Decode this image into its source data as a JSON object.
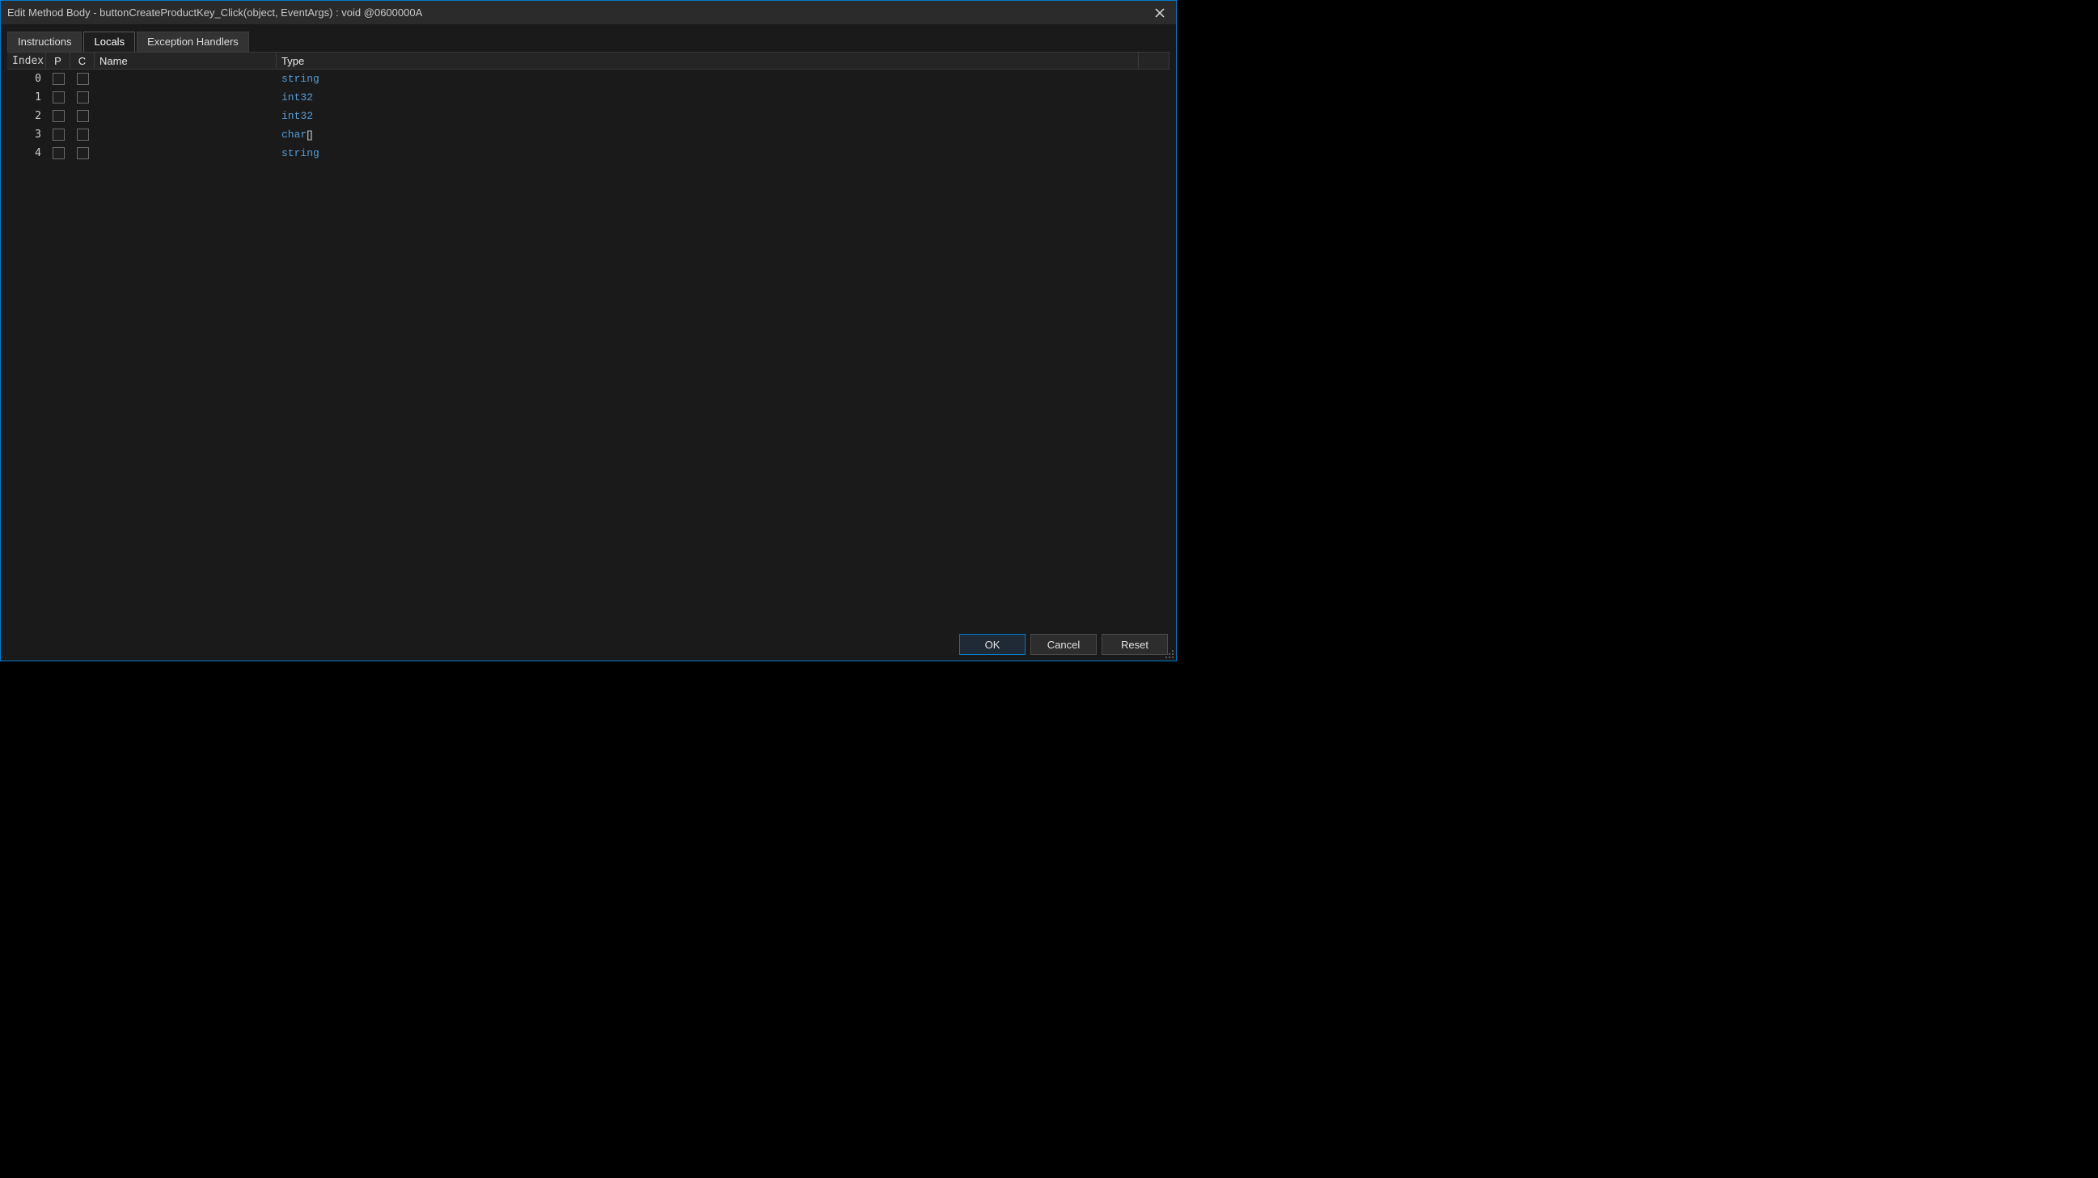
{
  "window": {
    "title": "Edit Method Body - buttonCreateProductKey_Click(object, EventArgs) : void @0600000A"
  },
  "tabs": [
    {
      "label": "Instructions",
      "active": false
    },
    {
      "label": "Locals",
      "active": true
    },
    {
      "label": "Exception Handlers",
      "active": false
    }
  ],
  "columns": {
    "index": "Index",
    "p": "P",
    "c": "C",
    "name": "Name",
    "type": "Type"
  },
  "rows": [
    {
      "index": "0",
      "p": false,
      "c": false,
      "name": "",
      "type_keyword": "string",
      "type_suffix": ""
    },
    {
      "index": "1",
      "p": false,
      "c": false,
      "name": "",
      "type_keyword": "int32",
      "type_suffix": ""
    },
    {
      "index": "2",
      "p": false,
      "c": false,
      "name": "",
      "type_keyword": "int32",
      "type_suffix": ""
    },
    {
      "index": "3",
      "p": false,
      "c": false,
      "name": "",
      "type_keyword": "char",
      "type_suffix": "[]"
    },
    {
      "index": "4",
      "p": false,
      "c": false,
      "name": "",
      "type_keyword": "string",
      "type_suffix": ""
    }
  ],
  "buttons": {
    "ok": "OK",
    "cancel": "Cancel",
    "reset": "Reset"
  }
}
